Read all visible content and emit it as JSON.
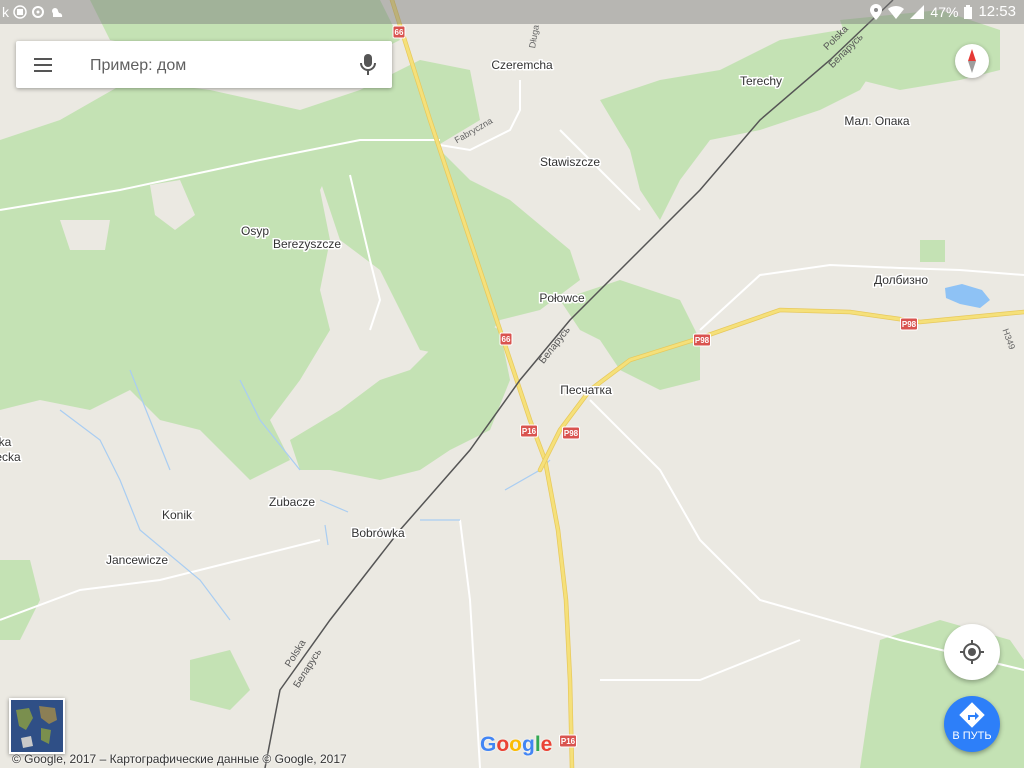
{
  "status_bar": {
    "left_text": "k",
    "time": "12:53",
    "battery": "47%"
  },
  "search": {
    "placeholder": "Пример: дом"
  },
  "places": [
    {
      "name": "Czeremcha"
    },
    {
      "name": "Terechy"
    },
    {
      "name": "Мал. Опака"
    },
    {
      "name": "Stawiszcze"
    },
    {
      "name": "Osyp"
    },
    {
      "name": "Berezyszcze"
    },
    {
      "name": "Долбизно"
    },
    {
      "name": "Połowce"
    },
    {
      "name": "Песчатка"
    },
    {
      "name": "ka"
    },
    {
      "name": "ecka"
    },
    {
      "name": "Zubacze"
    },
    {
      "name": "Konik"
    },
    {
      "name": "Bobrówka"
    },
    {
      "name": "Jancewicze"
    }
  ],
  "streets": [
    {
      "name": "Fabryczna"
    },
    {
      "name": "Długa"
    },
    {
      "name": "Н349"
    }
  ],
  "border_labels": [
    {
      "name": "Polska"
    },
    {
      "name": "Беларусь"
    },
    {
      "name": "Беларусь"
    },
    {
      "name": "Polska"
    },
    {
      "name": "Беларусь"
    }
  ],
  "road_shields": [
    {
      "label": "66"
    },
    {
      "label": "66"
    },
    {
      "label": "P98"
    },
    {
      "label": "P98"
    },
    {
      "label": "P16"
    },
    {
      "label": "P98"
    },
    {
      "label": "P16"
    }
  ],
  "route_button": {
    "label": "В ПУТЬ"
  },
  "copyright": "© Google, 2017 – Картографические данные © Google, 2017",
  "logo": {
    "letters": [
      "G",
      "o",
      "o",
      "g",
      "l",
      "e"
    ],
    "colors": [
      "#4285f4",
      "#ea4335",
      "#fbbc05",
      "#4285f4",
      "#34a853",
      "#ea4335"
    ]
  },
  "colors": {
    "land": "#ebe9e2",
    "forest": "#c4e2b4",
    "road": "#f5e07a",
    "shield": "#d9534f",
    "accent": "#2d7ff9",
    "water": "#8ec2f5"
  }
}
